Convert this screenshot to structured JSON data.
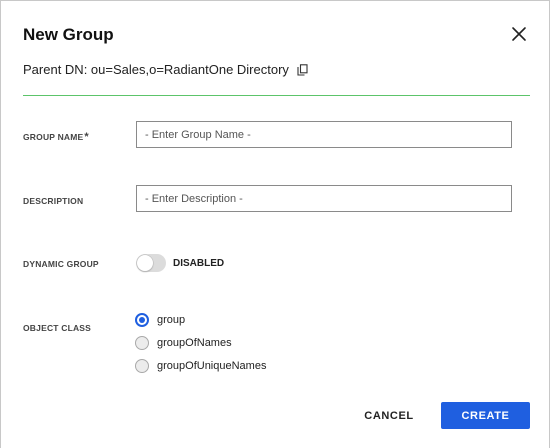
{
  "dialog": {
    "title": "New Group",
    "parent_dn": "Parent DN: ou=Sales,o=RadiantOne Directory",
    "accent_color": "#5cc46a",
    "primary_color": "#1f5fe0"
  },
  "fields": {
    "group_name": {
      "label": "GROUP NAME",
      "required_mark": "*",
      "placeholder": "- Enter Group Name -",
      "value": ""
    },
    "description": {
      "label": "DESCRIPTION",
      "placeholder": "- Enter Description -",
      "value": ""
    },
    "dynamic_group": {
      "label": "DYNAMIC GROUP",
      "state_text": "DISABLED",
      "enabled": false
    },
    "object_class": {
      "label": "OBJECT CLASS",
      "selected": "group",
      "options": [
        "group",
        "groupOfNames",
        "groupOfUniqueNames"
      ]
    }
  },
  "buttons": {
    "cancel": "CANCEL",
    "create": "CREATE"
  },
  "icons": {
    "close": "close-icon",
    "copy": "copy-icon"
  }
}
